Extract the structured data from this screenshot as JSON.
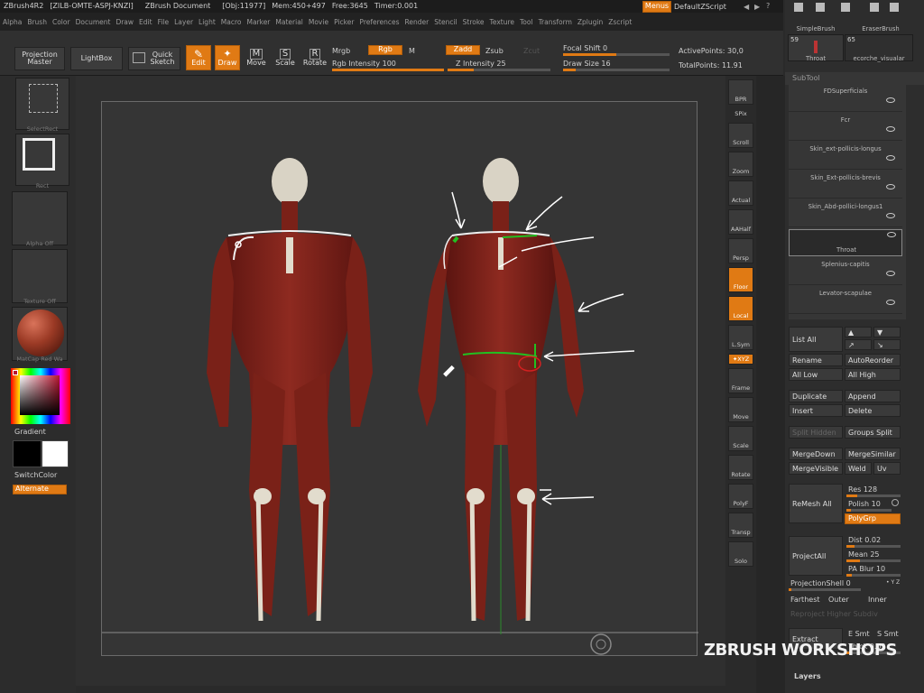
{
  "app": {
    "name": "ZBrush4R2",
    "serial": "[ZILB-OMTE-ASPJ-KNZI]",
    "doc": "ZBrush Document",
    "obj": "[Obj:11977]",
    "mem": "Mem:450+497",
    "free": "Free:3645",
    "timer": "Timer:0.001"
  },
  "title_right": {
    "menus": "Menus",
    "script": "DefaultZScript"
  },
  "menus": [
    "Alpha",
    "Brush",
    "Color",
    "Document",
    "Draw",
    "Edit",
    "File",
    "Layer",
    "Light",
    "Macro",
    "Marker",
    "Material",
    "Movie",
    "Picker",
    "Preferences",
    "Render",
    "Stencil",
    "Stroke",
    "Texture",
    "Tool",
    "Transform",
    "Zplugin",
    "Zscript"
  ],
  "toolbar": {
    "projection_master": "Projection Master",
    "lightbox": "LightBox",
    "quick_sketch": "Quick Sketch",
    "edit": "Edit",
    "draw": "Draw",
    "move": "Move",
    "scale": "Scale",
    "rotate": "Rotate",
    "mrgb": "Mrgb",
    "rgb": "Rgb",
    "m": "M",
    "rgb_intensity": "Rgb Intensity 100",
    "zadd": "Zadd",
    "zsub": "Zsub",
    "zcut": "Zcut",
    "z_intensity": "Z Intensity 25",
    "focal_shift": "Focal Shift 0",
    "draw_size": "Draw Size 16",
    "active_points": "ActivePoints: 30,0",
    "total_points": "TotalPoints: 11.91"
  },
  "left": {
    "selectrect": "SelectRect",
    "rect": "Rect",
    "alpha_off": "Alpha Off",
    "texture_off": "Texture Off",
    "matcap": "MatCap Red Wa",
    "gradient": "Gradient",
    "switchcolor": "SwitchColor",
    "alternate": "Alternate"
  },
  "righttools": [
    {
      "name": "bpr",
      "label": "BPR"
    },
    {
      "name": "spix",
      "label": "SPix"
    },
    {
      "name": "scroll",
      "label": "Scroll"
    },
    {
      "name": "zoom",
      "label": "Zoom"
    },
    {
      "name": "actual",
      "label": "Actual"
    },
    {
      "name": "aahalf",
      "label": "AAHalf"
    },
    {
      "name": "persp",
      "label": "Persp"
    },
    {
      "name": "floor",
      "label": "Floor"
    },
    {
      "name": "local",
      "label": "Local"
    },
    {
      "name": "lsym",
      "label": "L.Sym"
    },
    {
      "name": "xyz",
      "label": "✦XYZ"
    },
    {
      "name": "frame",
      "label": "Frame"
    },
    {
      "name": "move",
      "label": "Move"
    },
    {
      "name": "scale",
      "label": "Scale"
    },
    {
      "name": "rotate",
      "label": "Rotate"
    },
    {
      "name": "polyf",
      "label": "PolyF"
    },
    {
      "name": "transp",
      "label": "Transp"
    },
    {
      "name": "solo",
      "label": "Solo"
    }
  ],
  "tray": {
    "brush1": "SimpleBrush",
    "brush2": "EraserBrush",
    "num1": "59",
    "num2": "65",
    "brush3": "Throat",
    "brush4": "ecorche_visualar",
    "subtool_title": "SubTool",
    "subtools": [
      "FDSuperficials",
      "Fcr",
      "Skin_ext-pollicis-longus",
      "Skin_Ext-pollicis-brevis",
      "Skin_Abd-pollici-longus1",
      "Throat",
      "Splenius-capitis",
      "Levator-scapulae"
    ],
    "list_all": "List All",
    "rename": "Rename",
    "autoreorder": "AutoReorder",
    "all_low": "All Low",
    "all_high": "All High",
    "duplicate": "Duplicate",
    "append": "Append",
    "insert": "Insert",
    "delete": "Delete",
    "split_hidden": "Split Hidden",
    "groups_split": "Groups Split",
    "mergedown": "MergeDown",
    "mergesimilar": "MergeSimilar",
    "mergevisible": "MergeVisible",
    "weld": "Weld",
    "uv": "Uv",
    "remesh_all": "ReMesh All",
    "res": "Res 128",
    "polish": "Polish 10",
    "polygrp": "PolyGrp",
    "projectall": "ProjectAll",
    "dist": "Dist 0.02",
    "mean": "Mean 25",
    "pablur": "PA Blur 10",
    "projectionshell": "ProjectionShell 0",
    "xyz": "• Y Z",
    "farthest": "Farthest",
    "outer": "Outer",
    "inner": "Inner",
    "reproject": "Reproject Higher Subdiv",
    "extract": "Extract",
    "esmt": "E Smt",
    "ssmt": "S Smt",
    "thick": "Thick 0.02",
    "layers": "Layers"
  },
  "watermark": "ZBRUSH WORKSHOPS"
}
